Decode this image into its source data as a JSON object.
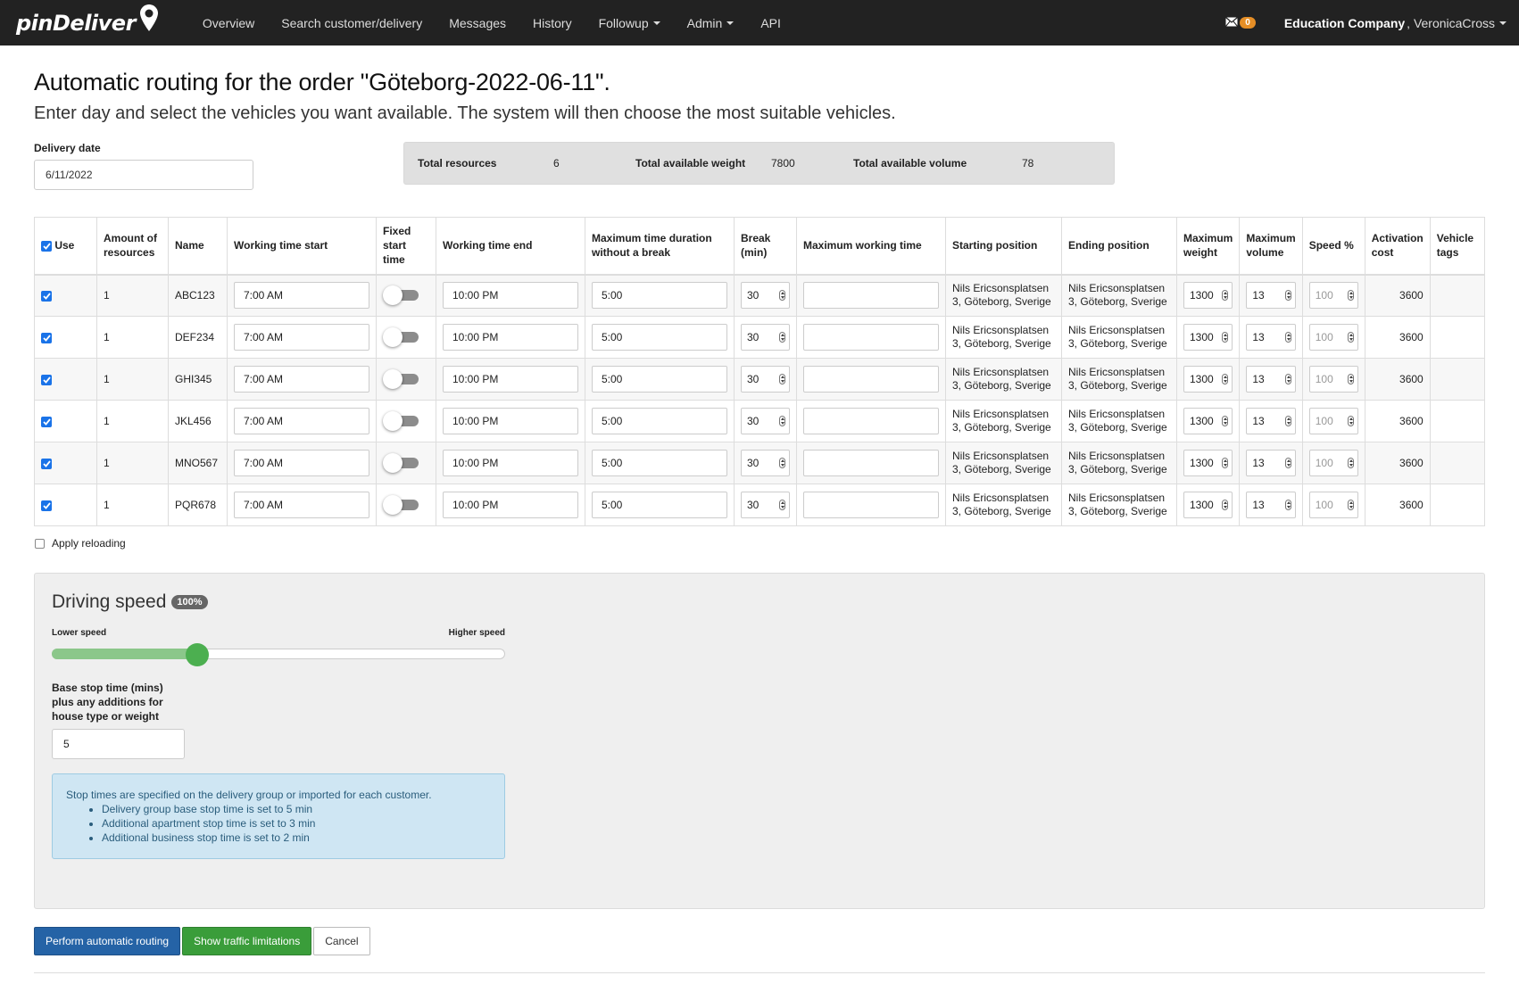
{
  "nav": {
    "brand": "pinDeliver",
    "items": [
      {
        "label": "Overview",
        "dropdown": false
      },
      {
        "label": "Search customer/delivery",
        "dropdown": false
      },
      {
        "label": "Messages",
        "dropdown": false
      },
      {
        "label": "History",
        "dropdown": false
      },
      {
        "label": "Followup",
        "dropdown": true
      },
      {
        "label": "Admin",
        "dropdown": true
      },
      {
        "label": "API",
        "dropdown": false
      }
    ],
    "mail_count": "0",
    "company": "Education Company",
    "user": ", VeronicaCross"
  },
  "page": {
    "title": "Automatic routing for the order \"Göteborg-2022-06-11\".",
    "lead": "Enter day and select the vehicles you want available. The system will then choose the most suitable vehicles."
  },
  "delivery_date": {
    "label": "Delivery date",
    "value": "6/11/2022"
  },
  "totals": {
    "resources_label": "Total resources",
    "resources": "6",
    "weight_label": "Total available weight",
    "weight": "7800",
    "volume_label": "Total available volume",
    "volume": "78"
  },
  "table": {
    "headers": {
      "use": "Use",
      "amount": "Amount of resources",
      "name": "Name",
      "start": "Working time start",
      "fixed": "Fixed start time",
      "end": "Working time end",
      "maxdur": "Maximum time duration without a break",
      "break": "Break (min)",
      "maxwork": "Maximum working time",
      "startpos": "Starting position",
      "endpos": "Ending position",
      "maxweight": "Maximum weight",
      "maxvol": "Maximum volume",
      "speed": "Speed %",
      "cost": "Activation cost",
      "tags": "Vehicle tags"
    },
    "rows": [
      {
        "use": true,
        "amount": "1",
        "name": "ABC123",
        "start": "7:00 AM",
        "fixed": false,
        "end": "10:00 PM",
        "maxdur": "5:00",
        "break": "30",
        "maxwork": "",
        "startpos": "Nils Ericsonsplatsen 3, Göteborg, Sverige",
        "endpos": "Nils Ericsonsplatsen 3, Göteborg, Sverige",
        "maxweight": "1300",
        "maxvol": "13",
        "speed": "100",
        "cost": "3600",
        "tags": ""
      },
      {
        "use": true,
        "amount": "1",
        "name": "DEF234",
        "start": "7:00 AM",
        "fixed": false,
        "end": "10:00 PM",
        "maxdur": "5:00",
        "break": "30",
        "maxwork": "",
        "startpos": "Nils Ericsonsplatsen 3, Göteborg, Sverige",
        "endpos": "Nils Ericsonsplatsen 3, Göteborg, Sverige",
        "maxweight": "1300",
        "maxvol": "13",
        "speed": "100",
        "cost": "3600",
        "tags": ""
      },
      {
        "use": true,
        "amount": "1",
        "name": "GHI345",
        "start": "7:00 AM",
        "fixed": false,
        "end": "10:00 PM",
        "maxdur": "5:00",
        "break": "30",
        "maxwork": "",
        "startpos": "Nils Ericsonsplatsen 3, Göteborg, Sverige",
        "endpos": "Nils Ericsonsplatsen 3, Göteborg, Sverige",
        "maxweight": "1300",
        "maxvol": "13",
        "speed": "100",
        "cost": "3600",
        "tags": ""
      },
      {
        "use": true,
        "amount": "1",
        "name": "JKL456",
        "start": "7:00 AM",
        "fixed": false,
        "end": "10:00 PM",
        "maxdur": "5:00",
        "break": "30",
        "maxwork": "",
        "startpos": "Nils Ericsonsplatsen 3, Göteborg, Sverige",
        "endpos": "Nils Ericsonsplatsen 3, Göteborg, Sverige",
        "maxweight": "1300",
        "maxvol": "13",
        "speed": "100",
        "cost": "3600",
        "tags": ""
      },
      {
        "use": true,
        "amount": "1",
        "name": "MNO567",
        "start": "7:00 AM",
        "fixed": false,
        "end": "10:00 PM",
        "maxdur": "5:00",
        "break": "30",
        "maxwork": "",
        "startpos": "Nils Ericsonsplatsen 3, Göteborg, Sverige",
        "endpos": "Nils Ericsonsplatsen 3, Göteborg, Sverige",
        "maxweight": "1300",
        "maxvol": "13",
        "speed": "100",
        "cost": "3600",
        "tags": ""
      },
      {
        "use": true,
        "amount": "1",
        "name": "PQR678",
        "start": "7:00 AM",
        "fixed": false,
        "end": "10:00 PM",
        "maxdur": "5:00",
        "break": "30",
        "maxwork": "",
        "startpos": "Nils Ericsonsplatsen 3, Göteborg, Sverige",
        "endpos": "Nils Ericsonsplatsen 3, Göteborg, Sverige",
        "maxweight": "1300",
        "maxvol": "13",
        "speed": "100",
        "cost": "3600",
        "tags": ""
      }
    ]
  },
  "apply_reloading": {
    "label": "Apply reloading",
    "checked": false
  },
  "driving_speed": {
    "title": "Driving speed",
    "badge": "100%",
    "lower_label": "Lower speed",
    "higher_label": "Higher speed",
    "slider_fraction": 0.32,
    "base_stop_label": "Base stop time (mins) plus any additions for house type or weight",
    "base_stop_value": "5",
    "info_text": "Stop times are specified on the delivery group or imported for each customer.",
    "info_items": [
      "Delivery group base stop time is set to 5 min",
      "Additional apartment stop time is set to 3 min",
      "Additional business stop time is set to 2 min"
    ]
  },
  "buttons": {
    "perform": "Perform automatic routing",
    "traffic": "Show traffic limitations",
    "cancel": "Cancel"
  },
  "colors": {
    "navbar": "#222222",
    "primary": "#2563a6",
    "success": "#3a9d3a",
    "badge": "#e58e26",
    "slider": "#4caf50"
  }
}
